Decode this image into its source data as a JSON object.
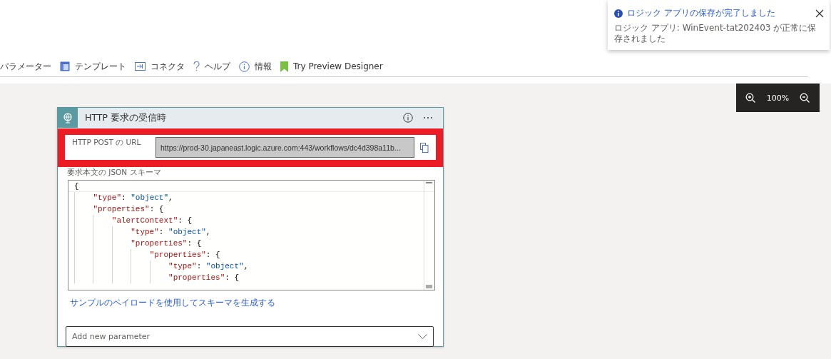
{
  "toolbar": [
    {
      "kind": "none",
      "label": "パラメーター"
    },
    {
      "kind": "template",
      "label": "テンプレート"
    },
    {
      "kind": "connector",
      "label": "コネクタ"
    },
    {
      "kind": "help",
      "label": "ヘルプ"
    },
    {
      "kind": "info",
      "label": "情報"
    },
    {
      "kind": "preview",
      "label": "Try Preview Designer"
    }
  ],
  "toast": {
    "title": "ロジック アプリの保存が完了しました",
    "message": "ロジック アプリ: WinEvent-tat202403 が正常に保存されました"
  },
  "zoom": {
    "level_text": "100%"
  },
  "card": {
    "title": "HTTP 要求の受信時",
    "url_label": "HTTP POST の URL",
    "url_value": "https://prod-30.japaneast.logic.azure.com:443/workflows/dc4d398a11b...",
    "schema_label": "要求本文の JSON スキーマ",
    "schema_lines": [
      "{",
      "    \"type\": \"object\",",
      "    \"properties\": {",
      "        \"alertContext\": {",
      "            \"type\": \"object\",",
      "            \"properties\": {",
      "                \"properties\": {",
      "                    \"type\": \"object\",",
      "                    \"properties\": {"
    ],
    "generate_link": "サンプルのペイロードを使用してスキーマを生成する",
    "parameter_placeholder": "Add new parameter"
  }
}
